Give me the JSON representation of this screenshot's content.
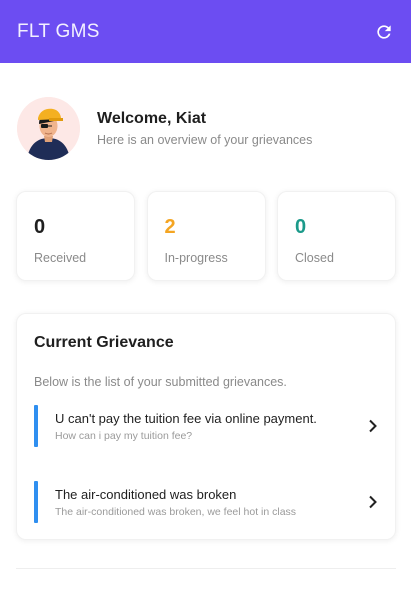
{
  "appbar": {
    "title": "FLT GMS",
    "icon": "refresh-icon",
    "color": "#6c4df2"
  },
  "welcome": {
    "title": "Welcome, Kiat",
    "subtitle": "Here is an overview of your grievances",
    "avatar_icon": "user-avatar"
  },
  "stats": [
    {
      "value": "0",
      "label": "Received",
      "color": "#1f1f1f"
    },
    {
      "value": "2",
      "label": "In-progress",
      "color": "#f4a522"
    },
    {
      "value": "0",
      "label": "Closed",
      "color": "#1b9a8a"
    }
  ],
  "grievances": {
    "title": "Current Grievance",
    "subtitle": "Below is the list of your submitted grievances.",
    "items": [
      {
        "title": "U can't pay the tuition fee via online payment.",
        "description": "How can i pay my tuition fee?"
      },
      {
        "title": "The air-conditioned was broken",
        "description": "The air-conditioned was broken, we feel hot in class"
      }
    ],
    "accent_color": "#2f8ff0"
  }
}
